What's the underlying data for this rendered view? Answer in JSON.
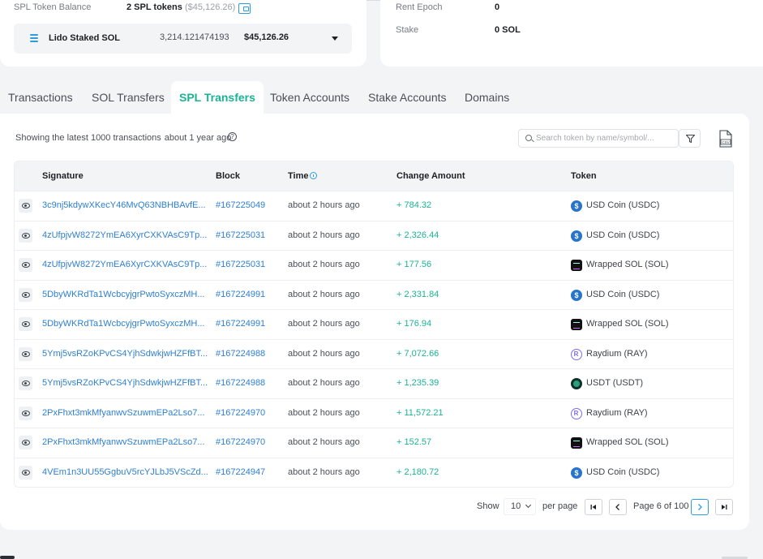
{
  "balance": {
    "label": "SPL Token Balance",
    "value": "2 SPL tokens",
    "value_usd": "($45,126.26)",
    "lido": {
      "name": "Lido Staked SOL",
      "amount": "3,214.121474193",
      "usd": "$45,126.26"
    }
  },
  "stake": {
    "rent_epoch_label": "Rent Epoch",
    "rent_epoch_value": "0",
    "stake_label": "Stake",
    "stake_value": "0 SOL"
  },
  "tabs": [
    {
      "label": "Transactions"
    },
    {
      "label": "SOL Transfers"
    },
    {
      "label": "SPL Transfers"
    },
    {
      "label": "Token Accounts"
    },
    {
      "label": "Stake Accounts"
    },
    {
      "label": "Domains"
    }
  ],
  "active_tab": "SPL Transfers",
  "panel": {
    "showing": "Showing the latest 1000 transactions",
    "ago": "about 1 year ago",
    "search_placeholder": "Search token by name/symbol/..."
  },
  "table": {
    "headers": {
      "signature": "Signature",
      "block": "Block",
      "time": "Time",
      "change": "Change Amount",
      "token": "Token"
    },
    "rows": [
      {
        "signature": "3c9nj5kdywXKecY46MvQ63NBHBAvfE...",
        "block": "#167225049",
        "time": "about 2 hours ago",
        "change": "+ 784.32",
        "token": "USD Coin (USDC)",
        "icon": "usdc-icon"
      },
      {
        "signature": "4zUfpjvW8272YmEA6XyrCXKVAsC9Tp...",
        "block": "#167225031",
        "time": "about 2 hours ago",
        "change": "+ 2,326.44",
        "token": "USD Coin (USDC)",
        "icon": "usdc-icon"
      },
      {
        "signature": "4zUfpjvW8272YmEA6XyrCXKVAsC9Tp...",
        "block": "#167225031",
        "time": "about 2 hours ago",
        "change": "+ 177.56",
        "token": "Wrapped SOL (SOL)",
        "icon": "sol-icon"
      },
      {
        "signature": "5DbyWKRdTa1WcbcyjgrPwtoSyxczMH...",
        "block": "#167224991",
        "time": "about 2 hours ago",
        "change": "+ 2,331.84",
        "token": "USD Coin (USDC)",
        "icon": "usdc-icon"
      },
      {
        "signature": "5DbyWKRdTa1WcbcyjgrPwtoSyxczMH...",
        "block": "#167224991",
        "time": "about 2 hours ago",
        "change": "+ 176.94",
        "token": "Wrapped SOL (SOL)",
        "icon": "sol-icon"
      },
      {
        "signature": "5Ymj5vsRZoKPvCS4YjhSdwkjwHZFfBT...",
        "block": "#167224988",
        "time": "about 2 hours ago",
        "change": "+ 7,072.66",
        "token": "Raydium (RAY)",
        "icon": "ray-icon"
      },
      {
        "signature": "5Ymj5vsRZoKPvCS4YjhSdwkjwHZFfBT...",
        "block": "#167224988",
        "time": "about 2 hours ago",
        "change": "+ 1,235.39",
        "token": "USDT (USDT)",
        "icon": "usdt-icon"
      },
      {
        "signature": "2PxFhxt3mkMfyanwvSzuwmEPa2Lso7...",
        "block": "#167224970",
        "time": "about 2 hours ago",
        "change": "+ 11,572.21",
        "token": "Raydium (RAY)",
        "icon": "ray-icon"
      },
      {
        "signature": "2PxFhxt3mkMfyanwvSzuwmEPa2Lso7...",
        "block": "#167224970",
        "time": "about 2 hours ago",
        "change": "+ 152.57",
        "token": "Wrapped SOL (SOL)",
        "icon": "sol-icon"
      },
      {
        "signature": "4VEm1n3UU55GgbuV5rcYJLbJ5VScZd...",
        "block": "#167224947",
        "time": "about 2 hours ago",
        "change": "+ 2,180.72",
        "token": "USD Coin (USDC)",
        "icon": "usdc-icon"
      }
    ]
  },
  "pagination": {
    "show_label": "Show",
    "per_page_value": "10",
    "per_page_label": "per page",
    "page_text": "Page 6 of 100"
  },
  "colors": {
    "accent": "#1ab394",
    "link": "#2d7fd2",
    "icon_blue": "#2d9cdb"
  }
}
